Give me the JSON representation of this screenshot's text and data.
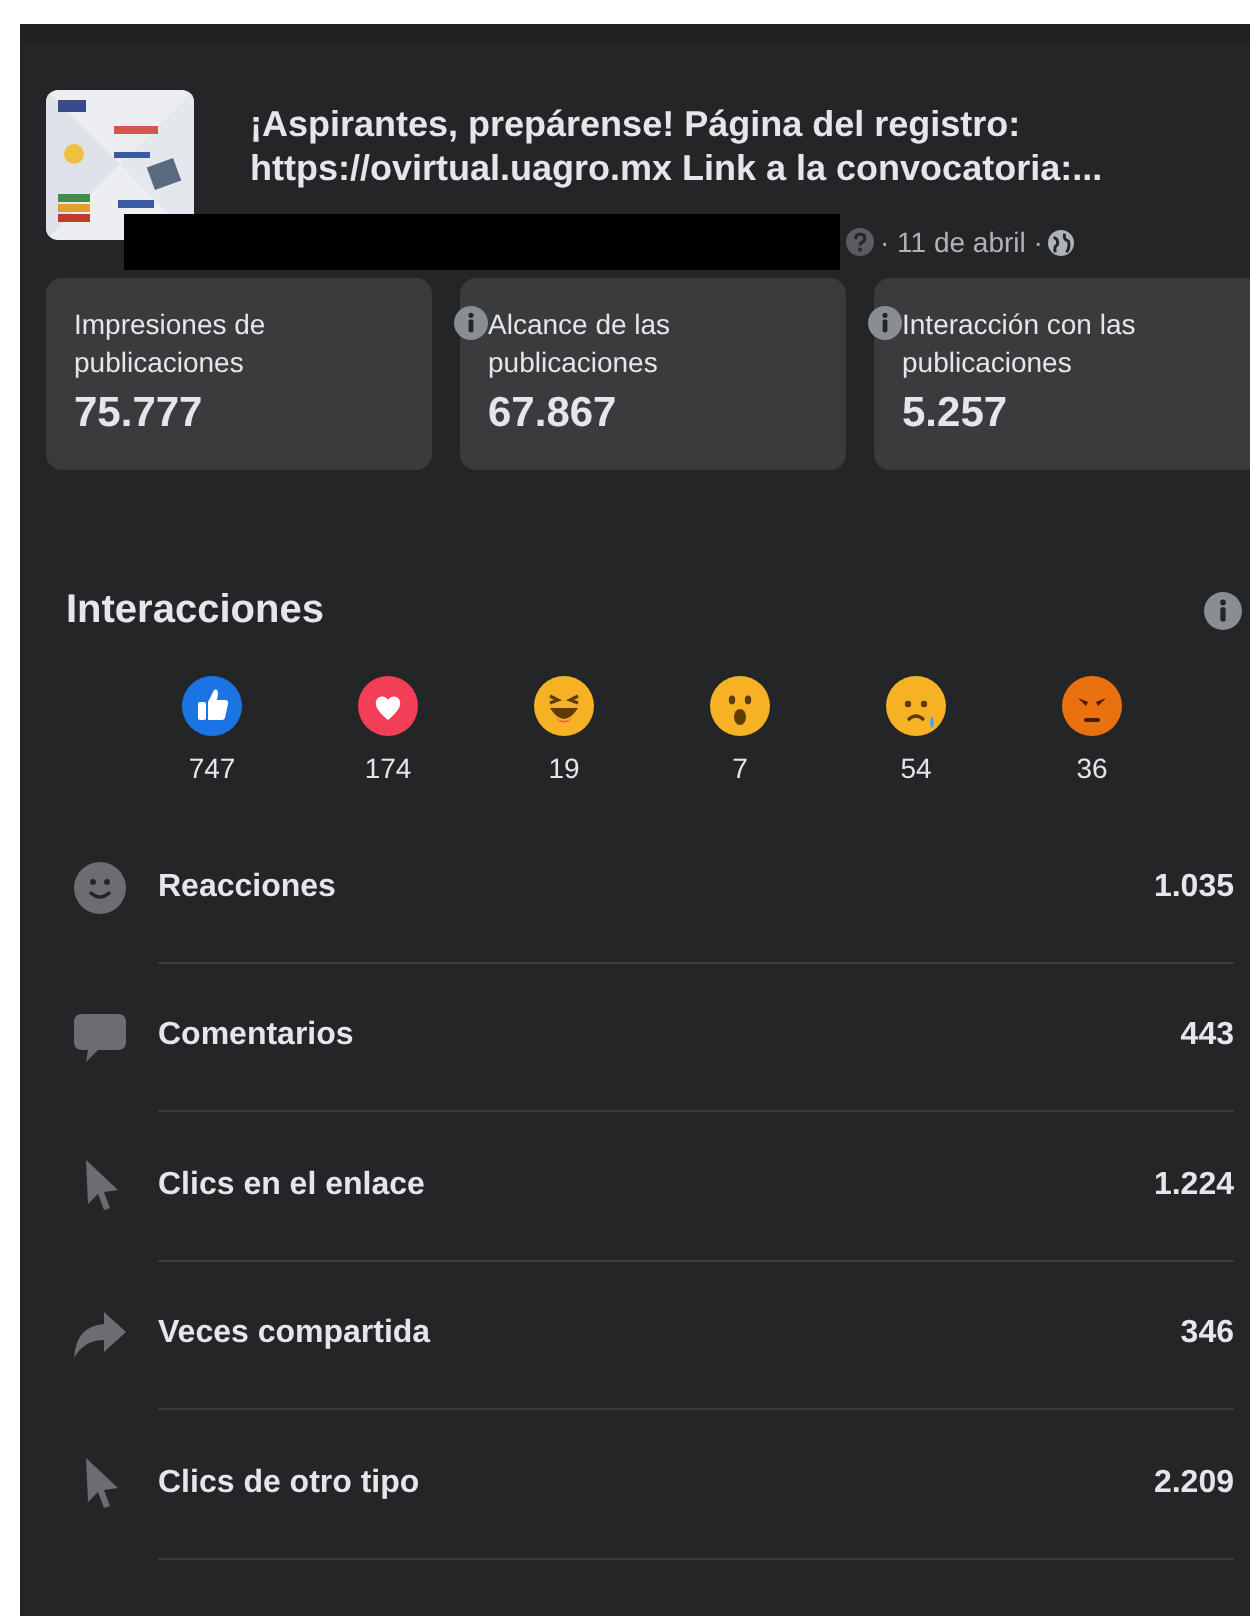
{
  "post": {
    "title": "¡Aspirantes, prepárense! Página del registro: https://ovirtual.uagro.mx Link a la convocatoria:...",
    "date": "· 11 de abril ·"
  },
  "stats": [
    {
      "label": "Impresiones de publicaciones",
      "value": "75.777",
      "info": false
    },
    {
      "label": "Alcance de las publicaciones",
      "value": "67.867",
      "info": true
    },
    {
      "label": "Interacción con las publicaciones",
      "value": "5.257",
      "info": true
    }
  ],
  "interactions": {
    "title": "Interacciones",
    "reactions": [
      {
        "kind": "like",
        "count": "747"
      },
      {
        "kind": "love",
        "count": "174"
      },
      {
        "kind": "haha",
        "count": "19"
      },
      {
        "kind": "wow",
        "count": "7"
      },
      {
        "kind": "sad",
        "count": "54"
      },
      {
        "kind": "angry",
        "count": "36"
      }
    ],
    "metrics": [
      {
        "kind": "reactions",
        "label": "Reacciones",
        "value": "1.035"
      },
      {
        "kind": "comments",
        "label": "Comentarios",
        "value": "443"
      },
      {
        "kind": "link_clicks",
        "label": "Clics en el enlace",
        "value": "1.224"
      },
      {
        "kind": "shares",
        "label": "Veces compartida",
        "value": "346"
      },
      {
        "kind": "other_clicks",
        "label": "Clics de otro tipo",
        "value": "2.209"
      }
    ]
  }
}
